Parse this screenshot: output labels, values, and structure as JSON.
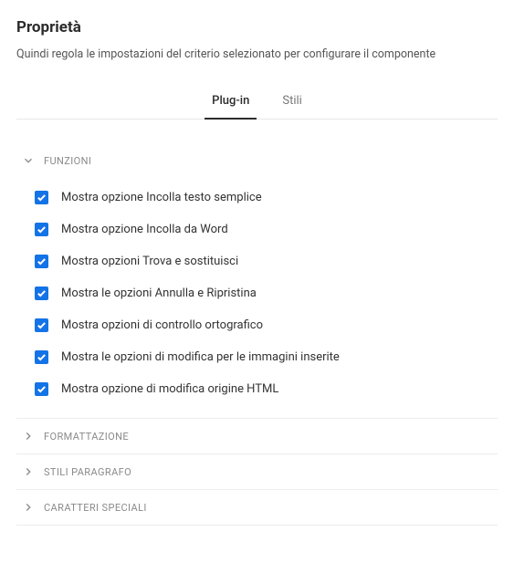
{
  "header": {
    "title": "Proprietà",
    "subtitle": "Quindi regola le impostazioni del criterio selezionato per configurare il componente"
  },
  "tabs": {
    "plugin": "Plug-in",
    "styles": "Stili"
  },
  "sections": {
    "funzioni": {
      "title": "FUNZIONI",
      "items": [
        "Mostra opzione Incolla testo semplice",
        "Mostra opzione Incolla da Word",
        "Mostra opzioni Trova e sostituisci",
        "Mostra le opzioni Annulla e Ripristina",
        "Mostra opzioni di controllo ortografico",
        "Mostra le opzioni di modifica per le immagini inserite",
        "Mostra opzione di modifica origine HTML"
      ]
    },
    "formattazione": {
      "title": "FORMATTAZIONE"
    },
    "stili_paragrafo": {
      "title": "STILI PARAGRAFO"
    },
    "caratteri_speciali": {
      "title": "CARATTERI SPECIALI"
    }
  }
}
